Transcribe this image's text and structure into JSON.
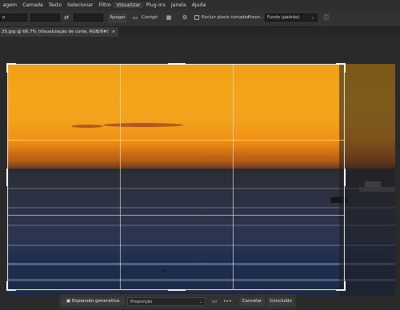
{
  "menu": [
    "agem",
    "Camada",
    "Texto",
    "Selecionar",
    "Filtro",
    "Visualizar",
    "Plug-ins",
    "Janela",
    "Ajuda"
  ],
  "menu_active_index": 5,
  "options": {
    "preset_label": "o",
    "straighten_icon": "swap-icon",
    "clear_label": "Apagar",
    "straighten_label": "Corrigir",
    "delete_pixels_label": "Excluir pixels cortados",
    "fill_label": "Preen.:",
    "fill_value": "Fundo (padrão)",
    "info_icon": "info-icon"
  },
  "tab": {
    "title": "25.jpg @ 66,7% (Visualização de corte, RGB/8#)",
    "close": "×"
  },
  "context": {
    "generative_expand_label": "Expansão generativa",
    "ratio_label": "Proporção",
    "more_label": "•••",
    "cancel_label": "Cancelar",
    "done_label": "Concluído"
  }
}
